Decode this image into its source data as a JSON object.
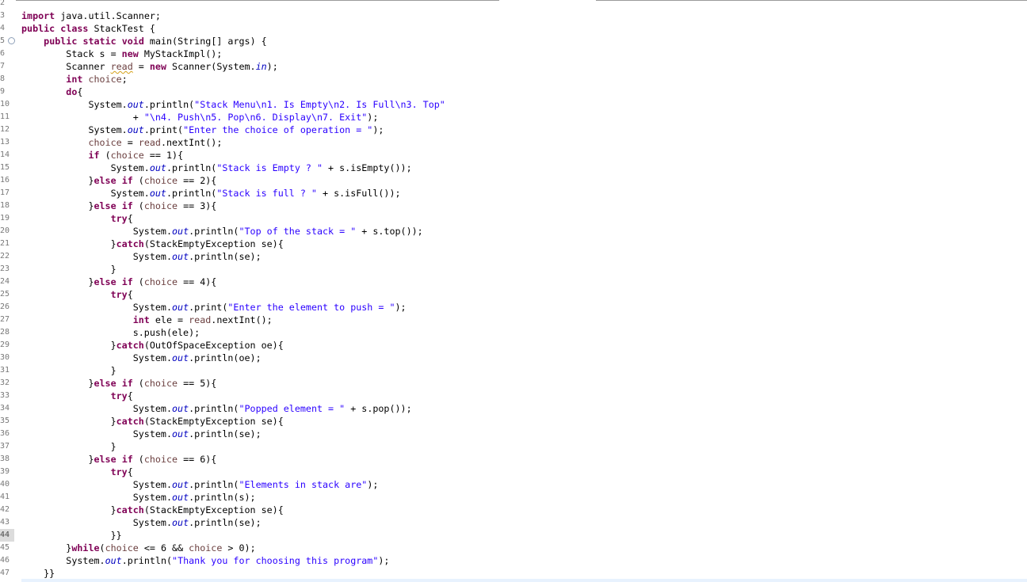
{
  "editor": {
    "language": "java",
    "fold_marker_glyph": "⊖",
    "lines": [
      {
        "n": "2",
        "code": ""
      },
      {
        "n": "3",
        "code": "import java.util.Scanner;"
      },
      {
        "n": "4",
        "code": "public class StackTest {"
      },
      {
        "n": "5",
        "code": "    public static void main(String[] args) {"
      },
      {
        "n": "6",
        "code": "        Stack s = new MyStackImpl();"
      },
      {
        "n": "7",
        "code": "        Scanner read = new Scanner(System.in);"
      },
      {
        "n": "8",
        "code": "        int choice;"
      },
      {
        "n": "9",
        "code": "        do{"
      },
      {
        "n": "10",
        "code": "            System.out.println(\"Stack Menu\\n1. Is Empty\\n2. Is Full\\n3. Top\""
      },
      {
        "n": "11",
        "code": "                    + \"\\n4. Push\\n5. Pop\\n6. Display\\n7. Exit\");"
      },
      {
        "n": "12",
        "code": "            System.out.print(\"Enter the choice of operation = \");"
      },
      {
        "n": "13",
        "code": "            choice = read.nextInt();"
      },
      {
        "n": "14",
        "code": "            if (choice == 1){"
      },
      {
        "n": "15",
        "code": "                System.out.println(\"Stack is Empty ? \" + s.isEmpty());"
      },
      {
        "n": "16",
        "code": "            }else if (choice == 2){"
      },
      {
        "n": "17",
        "code": "                System.out.println(\"Stack is full ? \" + s.isFull());"
      },
      {
        "n": "18",
        "code": "            }else if (choice == 3){"
      },
      {
        "n": "19",
        "code": "                try{"
      },
      {
        "n": "20",
        "code": "                    System.out.println(\"Top of the stack = \" + s.top());"
      },
      {
        "n": "21",
        "code": "                }catch(StackEmptyException se){"
      },
      {
        "n": "22",
        "code": "                    System.out.println(se);"
      },
      {
        "n": "23",
        "code": "                }"
      },
      {
        "n": "24",
        "code": "            }else if (choice == 4){"
      },
      {
        "n": "25",
        "code": "                try{"
      },
      {
        "n": "26",
        "code": "                    System.out.print(\"Enter the element to push = \");"
      },
      {
        "n": "27",
        "code": "                    int ele = read.nextInt();"
      },
      {
        "n": "28",
        "code": "                    s.push(ele);"
      },
      {
        "n": "29",
        "code": "                }catch(OutOfSpaceException oe){"
      },
      {
        "n": "30",
        "code": "                    System.out.println(oe);"
      },
      {
        "n": "31",
        "code": "                }"
      },
      {
        "n": "32",
        "code": "            }else if (choice == 5){"
      },
      {
        "n": "33",
        "code": "                try{"
      },
      {
        "n": "34",
        "code": "                    System.out.println(\"Popped element = \" + s.pop());"
      },
      {
        "n": "35",
        "code": "                }catch(StackEmptyException se){"
      },
      {
        "n": "36",
        "code": "                    System.out.println(se);"
      },
      {
        "n": "37",
        "code": "                }"
      },
      {
        "n": "38",
        "code": "            }else if (choice == 6){"
      },
      {
        "n": "39",
        "code": "                try{"
      },
      {
        "n": "40",
        "code": "                    System.out.println(\"Elements in stack are\");"
      },
      {
        "n": "41",
        "code": "                    System.out.println(s);"
      },
      {
        "n": "42",
        "code": "                }catch(StackEmptyException se){"
      },
      {
        "n": "43",
        "code": "                    System.out.println(se);"
      },
      {
        "n": "44",
        "code": "                }}"
      },
      {
        "n": "45",
        "code": "        }while(choice <= 6 && choice > 0);"
      },
      {
        "n": "46",
        "code": "        System.out.println(\"Thank you for choosing this program\");"
      },
      {
        "n": "47",
        "code": "    }}"
      }
    ],
    "current_line": "44",
    "fold_line": "5",
    "warning_token": "read",
    "colors": {
      "keyword": "#7f0055",
      "string": "#2a00ff",
      "static_field": "#0000c0",
      "local_variable": "#6a3e3e",
      "line_number": "#787878"
    }
  }
}
